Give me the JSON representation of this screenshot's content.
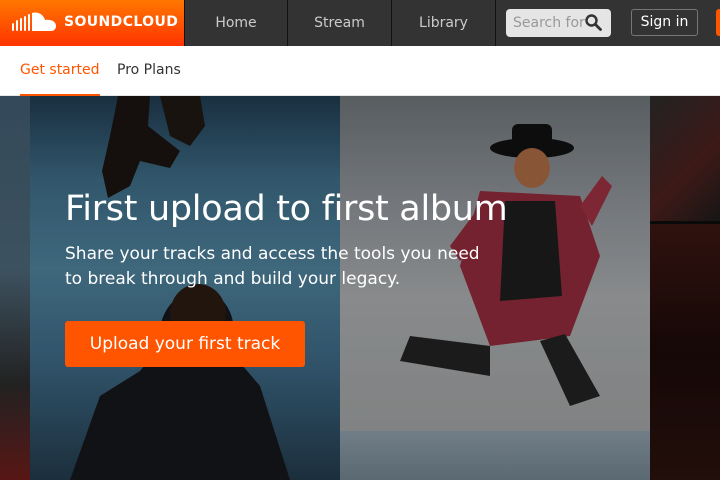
{
  "header": {
    "logo_text": "SOUNDCLOUD",
    "nav": [
      {
        "label": "Home"
      },
      {
        "label": "Stream"
      },
      {
        "label": "Library"
      }
    ],
    "search_placeholder": "Search for",
    "signin_label": "Sign in"
  },
  "subnav": {
    "tabs": [
      {
        "label": "Get started",
        "active": true
      },
      {
        "label": "Pro Plans",
        "active": false
      }
    ]
  },
  "hero": {
    "title": "First upload to first album",
    "subtitle": "Share your tracks and access the tools you need to break through and build your legacy.",
    "cta_label": "Upload your first track"
  },
  "colors": {
    "brand_orange": "#ff5500",
    "header_bg": "#333333"
  },
  "icons": [
    "soundcloud-logo-icon",
    "search-icon"
  ]
}
